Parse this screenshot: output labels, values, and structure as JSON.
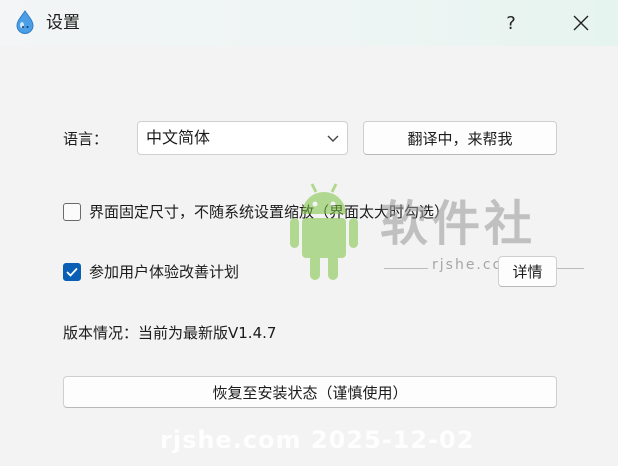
{
  "window": {
    "title": "设置",
    "help_label": "?"
  },
  "language": {
    "label": "语言：",
    "selected": "中文简体",
    "translate_button": "翻译中，来帮我"
  },
  "options": {
    "fixed_size": {
      "label": "界面固定尺寸，不随系统设置缩放（界面太大时勾选）",
      "checked": false
    },
    "ux_program": {
      "label": "参加用户体验改善计划",
      "checked": true,
      "details_button": "详情"
    }
  },
  "version": {
    "text": "版本情况：当前为最新版V1.4.7"
  },
  "reset_button": "恢复至安装状态（谨慎使用）",
  "watermark": {
    "brand": "软件社",
    "url": "rjshe.com",
    "bottom": "rjshe.com 2025-12-02"
  },
  "colors": {
    "checkbox_checked": "#0a5fb4",
    "app_icon": "#4a9fe6"
  }
}
